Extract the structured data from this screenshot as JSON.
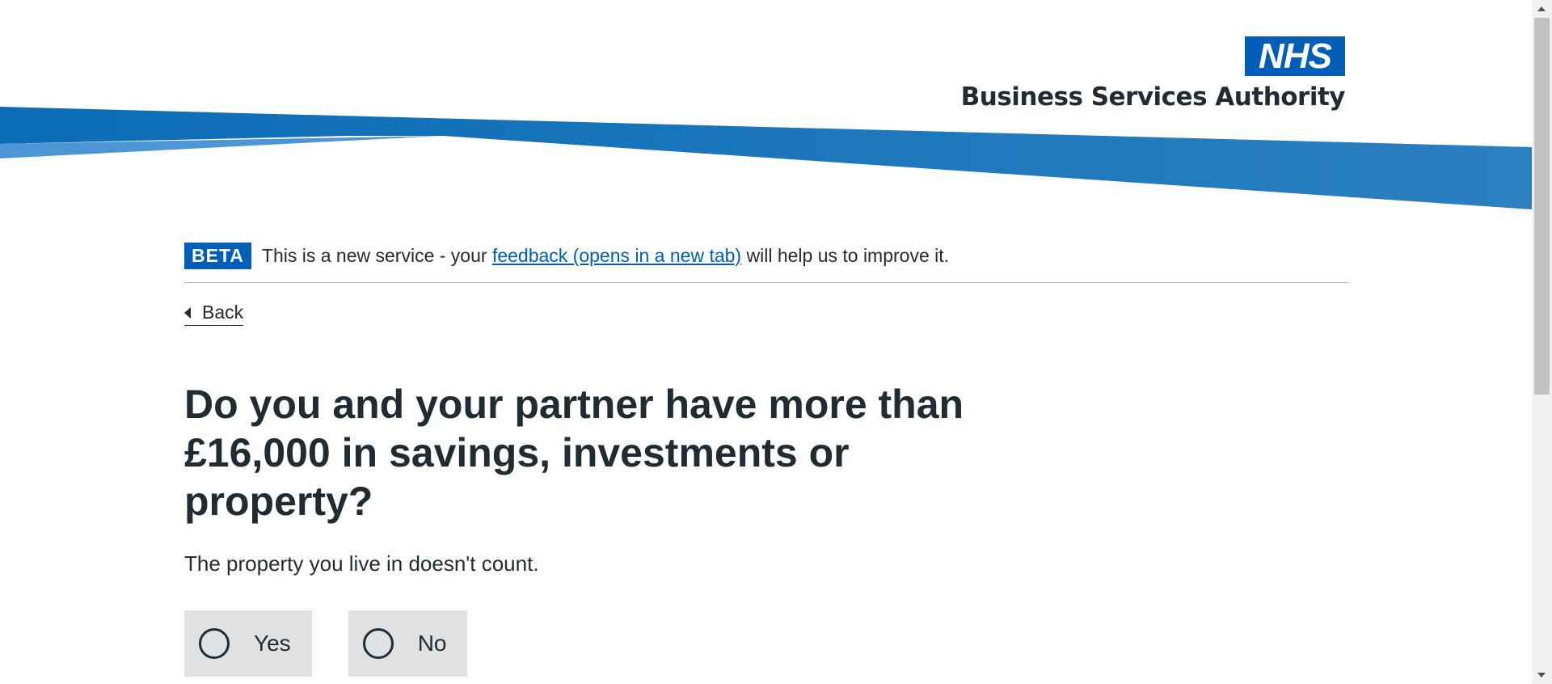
{
  "header": {
    "logo_box_text": "NHS",
    "organisation_name": "Business Services Authority"
  },
  "phase_banner": {
    "tag": "BETA",
    "text_before": "This is a new service - your ",
    "link_text": "feedback (opens in a new tab)",
    "text_after": " will help us to improve it."
  },
  "nav": {
    "back_label": "Back"
  },
  "question": {
    "title": "Do you and your partner have more than £16,000 in savings, investments or property?",
    "hint": "The property you live in doesn't count.",
    "options": [
      {
        "label": "Yes",
        "selected": false
      },
      {
        "label": "No",
        "selected": false
      }
    ]
  },
  "colors": {
    "nhs_blue": "#005eb8",
    "banner_blue": "#1874bb",
    "banner_light_blue": "#4d96d6",
    "text": "#212b32",
    "radio_background": "#dfe1e3"
  },
  "icons": {
    "back": "chevron-left-icon",
    "radio": "radio-circle-icon"
  }
}
